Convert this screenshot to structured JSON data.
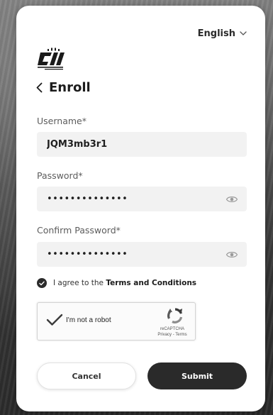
{
  "language": {
    "selected": "English"
  },
  "header": {
    "title": "Enroll"
  },
  "form": {
    "username": {
      "label": "Username*",
      "value": "JQM3mb3r1"
    },
    "password": {
      "label": "Password*",
      "masked": "••••••••••••••"
    },
    "confirm_password": {
      "label": "Confirm Password*",
      "masked": "••••••••••••••"
    }
  },
  "agreement": {
    "prefix": "I agree to the",
    "link": "Terms and Conditions",
    "checked": true
  },
  "recaptcha": {
    "label": "I'm not a robot",
    "brand": "reCAPTCHA",
    "links": "Privacy - Terms",
    "checked": true
  },
  "actions": {
    "cancel_label": "Cancel",
    "submit_label": "Submit"
  },
  "colors": {
    "primary": "#2a2a2a",
    "field_bg": "#f2f2f2",
    "accent_check": "#2b2b2b"
  }
}
